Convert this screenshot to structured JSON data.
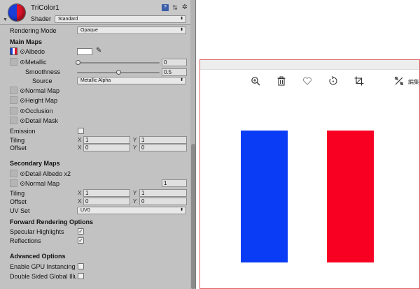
{
  "inspector": {
    "material_name": "TriColor1",
    "shader_label": "Shader",
    "shader_value": "Standard",
    "icons": [
      "book-icon",
      "preset-icon",
      "gear-icon"
    ],
    "rendering_mode_label": "Rendering Mode",
    "rendering_mode_value": "Opaque",
    "main_maps": {
      "title": "Main Maps",
      "albedo_label": "Albedo",
      "albedo_color": "#ffffff",
      "metallic_label": "Metallic",
      "metallic_value": "0",
      "smoothness_label": "Smoothness",
      "smoothness_value": "0.5",
      "source_label": "Source",
      "source_value": "Metallic Alpha",
      "normal_map_label": "Normal Map",
      "height_map_label": "Height Map",
      "occlusion_label": "Occlusion",
      "detail_mask_label": "Detail Mask",
      "emission_label": "Emission",
      "tiling_label": "Tiling",
      "tiling_x": "1",
      "tiling_y": "1",
      "offset_label": "Offset",
      "offset_x": "0",
      "offset_y": "0"
    },
    "secondary_maps": {
      "title": "Secondary Maps",
      "detail_albedo_label": "Detail Albedo x2",
      "normal_map_label": "Normal Map",
      "normal_map_value": "1",
      "tiling_label": "Tiling",
      "tiling_x": "1",
      "tiling_y": "1",
      "offset_label": "Offset",
      "offset_x": "0",
      "offset_y": "0",
      "uv_set_label": "UV Set",
      "uv_set_value": "UV0"
    },
    "forward_rendering": {
      "title": "Forward Rendering Options",
      "specular_label": "Specular Highlights",
      "specular_checked": true,
      "reflections_label": "Reflections",
      "reflections_checked": true
    },
    "advanced": {
      "title": "Advanced Options",
      "gpu_instancing_label": "Enable GPU Instancing",
      "gpu_instancing_checked": false,
      "double_sided_label": "Double Sided Global Illu",
      "double_sided_checked": false
    },
    "axis_x": "X",
    "axis_y": "Y"
  },
  "viewer": {
    "toolbar": {
      "zoom_icon": "zoom-in-icon",
      "delete_icon": "trash-icon",
      "favorite_icon": "heart-icon",
      "rotate_icon": "rotate-icon",
      "crop_icon": "crop-icon",
      "edit_icon": "edit-icon",
      "edit_label": "編集"
    },
    "image": {
      "left_bar_color": "#0b3cf5",
      "right_bar_color": "#f70022"
    }
  }
}
